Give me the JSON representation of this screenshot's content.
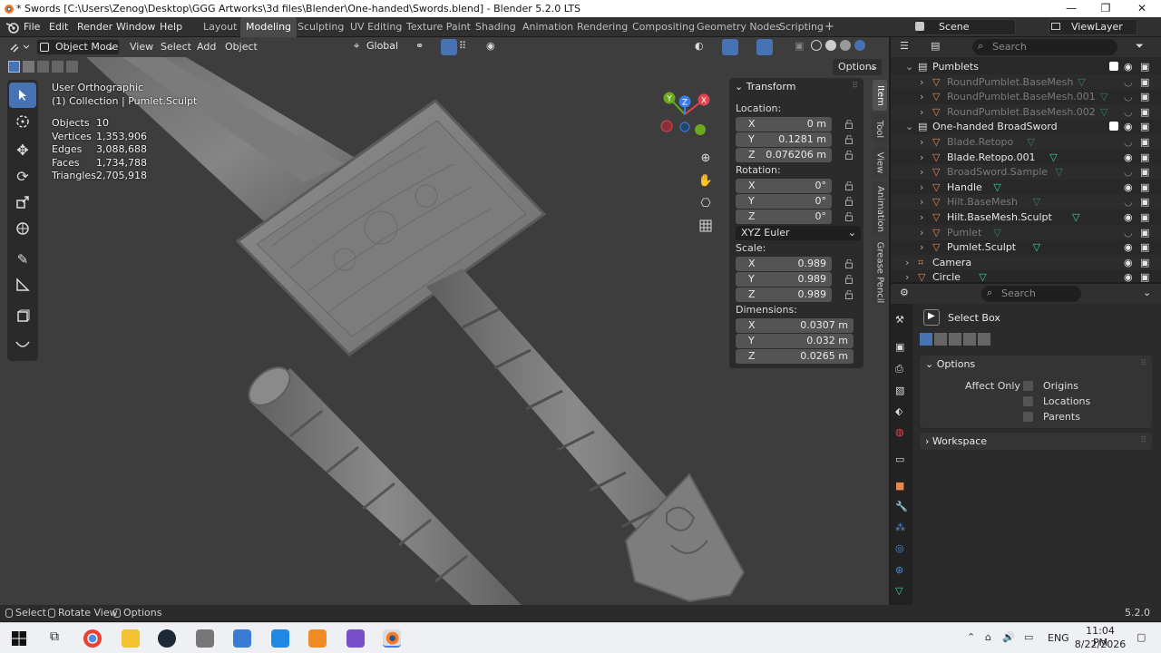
{
  "window": {
    "title": "* Swords [C:\\Users\\Zenog\\Desktop\\GGG Artworks\\3d files\\Blender\\One-handed\\Swords.blend] - Blender 5.2.0 LTS",
    "minimize": "—",
    "maximize": "❐",
    "close": "✕"
  },
  "menu": [
    "File",
    "Edit",
    "Render",
    "Window",
    "Help"
  ],
  "workspaces": [
    "Layout",
    "Modeling",
    "Sculpting",
    "UV Editing",
    "Texture Paint",
    "Shading",
    "Animation",
    "Rendering",
    "Compositing",
    "Geometry Nodes",
    "Scripting",
    "+"
  ],
  "active_workspace": "Modeling",
  "scene": {
    "label": "Scene",
    "view_layer": "ViewLayer"
  },
  "viewport_header": {
    "mode": "Object Mode",
    "menus": [
      "View",
      "Select",
      "Add",
      "Object"
    ],
    "transform_orientation": "Global",
    "options": "Options"
  },
  "viewport_overlay": {
    "view_name": "User Orthographic",
    "collection": "(1) Collection",
    "active_object": "Pumlet.Sculpt",
    "stats": [
      {
        "label": "Objects",
        "value": "10"
      },
      {
        "label": "Vertices",
        "value": "1,353,906"
      },
      {
        "label": "Edges",
        "value": "3,088,688"
      },
      {
        "label": "Faces",
        "value": "1,734,788"
      },
      {
        "label": "Triangles",
        "value": "2,705,918"
      }
    ]
  },
  "gizmo": {
    "x": "X",
    "y": "Y",
    "z": "Z"
  },
  "npanel": {
    "header": "Transform",
    "location_label": "Location:",
    "location": [
      {
        "ax": "X",
        "val": "0 m"
      },
      {
        "ax": "Y",
        "val": "0.1281 m"
      },
      {
        "ax": "Z",
        "val": "0.076206 m"
      }
    ],
    "rotation_label": "Rotation:",
    "rotation": [
      {
        "ax": "X",
        "val": "0°"
      },
      {
        "ax": "Y",
        "val": "0°"
      },
      {
        "ax": "Z",
        "val": "0°"
      }
    ],
    "rotation_mode": "XYZ Euler",
    "scale_label": "Scale:",
    "scale": [
      {
        "ax": "X",
        "val": "0.989"
      },
      {
        "ax": "Y",
        "val": "0.989"
      },
      {
        "ax": "Z",
        "val": "0.989"
      }
    ],
    "dimensions_label": "Dimensions:",
    "dimensions": [
      {
        "ax": "X",
        "val": "0.0307 m"
      },
      {
        "ax": "Y",
        "val": "0.032 m"
      },
      {
        "ax": "Z",
        "val": "0.0265 m"
      }
    ],
    "tabs": [
      "Item",
      "Tool",
      "View",
      "Animation",
      "Grease Pencil"
    ]
  },
  "outliner": {
    "search_placeholder": "Search",
    "rows": [
      {
        "name": "Pumblets",
        "indent": 1,
        "dim": false,
        "type": "collection"
      },
      {
        "name": "RoundPumblet.BaseMesh",
        "indent": 2,
        "dim": true,
        "type": "mesh"
      },
      {
        "name": "RoundPumblet.BaseMesh.001",
        "indent": 2,
        "dim": true,
        "type": "mesh"
      },
      {
        "name": "RoundPumblet.BaseMesh.002",
        "indent": 2,
        "dim": true,
        "type": "mesh"
      },
      {
        "name": "One-handed BroadSword",
        "indent": 1,
        "dim": false,
        "type": "collection"
      },
      {
        "name": "Blade.Retopo",
        "indent": 2,
        "dim": true,
        "type": "mesh"
      },
      {
        "name": "Blade.Retopo.001",
        "indent": 2,
        "dim": false,
        "type": "mesh"
      },
      {
        "name": "BroadSword.Sample",
        "indent": 2,
        "dim": true,
        "type": "mesh"
      },
      {
        "name": "Handle",
        "indent": 2,
        "dim": false,
        "type": "mesh"
      },
      {
        "name": "Hilt.BaseMesh",
        "indent": 2,
        "dim": true,
        "type": "mesh"
      },
      {
        "name": "Hilt.BaseMesh.Sculpt",
        "indent": 2,
        "dim": false,
        "type": "mesh"
      },
      {
        "name": "Pumlet",
        "indent": 2,
        "dim": true,
        "type": "mesh"
      },
      {
        "name": "Pumlet.Sculpt",
        "indent": 2,
        "dim": false,
        "type": "mesh"
      },
      {
        "name": "Camera",
        "indent": 1,
        "dim": false,
        "type": "camera"
      },
      {
        "name": "Circle",
        "indent": 1,
        "dim": false,
        "type": "mesh"
      }
    ]
  },
  "properties": {
    "search_placeholder": "Search",
    "tool_name": "Select Box",
    "options_header": "Options",
    "affect_only_label": "Affect Only",
    "affect_only": [
      "Origins",
      "Locations",
      "Parents"
    ],
    "workspace_header": "Workspace"
  },
  "statusbar": {
    "select": "Select",
    "rotate": "Rotate View",
    "options": "Options",
    "version": "5.2.0"
  },
  "taskbar": {
    "lang": "ENG",
    "time": "11:04 PM",
    "date": "8/22/2026"
  },
  "colors": {
    "accent": "#4772b3",
    "x_axis": "#e0444e",
    "y_axis": "#6ba81e",
    "z_axis": "#3a7ee8",
    "mesh_icon": "#e6894b",
    "tri_icon": "#38d39f"
  }
}
